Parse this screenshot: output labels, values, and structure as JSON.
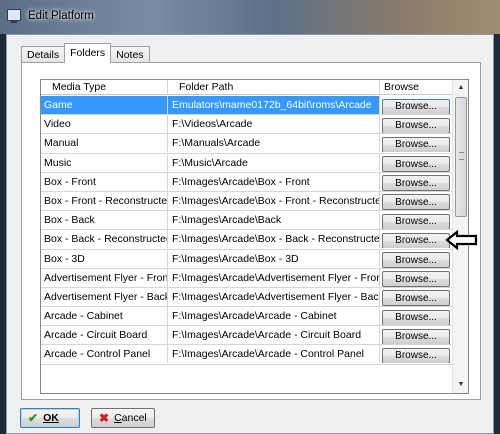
{
  "window": {
    "title": "Edit Platform"
  },
  "tabs": [
    {
      "label": "Details"
    },
    {
      "label": "Folders"
    },
    {
      "label": "Notes"
    }
  ],
  "grid": {
    "columns": [
      "Media Type",
      "Folder Path",
      "Browse"
    ],
    "browse_label": "Browse...",
    "rows": [
      {
        "type": "Game",
        "path": "Emulators\\mame0172b_64bit\\roms\\Arcade",
        "selected": true
      },
      {
        "type": "Video",
        "path": "F:\\Videos\\Arcade"
      },
      {
        "type": "Manual",
        "path": "F:\\Manuals\\Arcade"
      },
      {
        "type": "Music",
        "path": "F:\\Music\\Arcade"
      },
      {
        "type": "Box - Front",
        "path": "F:\\Images\\Arcade\\Box - Front"
      },
      {
        "type": "Box - Front - Reconstructed",
        "path": "F:\\Images\\Arcade\\Box - Front - Reconstructed"
      },
      {
        "type": "Box - Back",
        "path": "F:\\Images\\Arcade\\Back"
      },
      {
        "type": "Box - Back - Reconstructed",
        "path": "F:\\Images\\Arcade\\Box - Back - Reconstructed"
      },
      {
        "type": "Box - 3D",
        "path": "F:\\Images\\Arcade\\Box - 3D"
      },
      {
        "type": "Advertisement Flyer - Front",
        "path": "F:\\Images\\Arcade\\Advertisement Flyer - Front"
      },
      {
        "type": "Advertisement Flyer - Back",
        "path": "F:\\Images\\Arcade\\Advertisement Flyer - Back"
      },
      {
        "type": "Arcade - Cabinet",
        "path": "F:\\Images\\Arcade\\Arcade - Cabinet"
      },
      {
        "type": "Arcade - Circuit Board",
        "path": "F:\\Images\\Arcade\\Arcade - Circuit Board"
      },
      {
        "type": "Arcade - Control Panel",
        "path": "F:\\Images\\Arcade\\Arcade - Control Panel"
      }
    ]
  },
  "buttons": {
    "ok": "OK",
    "cancel_underlined": "C",
    "cancel_rest": "ancel"
  },
  "colors": {
    "selection": "#3399ff",
    "ok_check": "#2a9a2a",
    "cancel_x": "#d02020"
  }
}
